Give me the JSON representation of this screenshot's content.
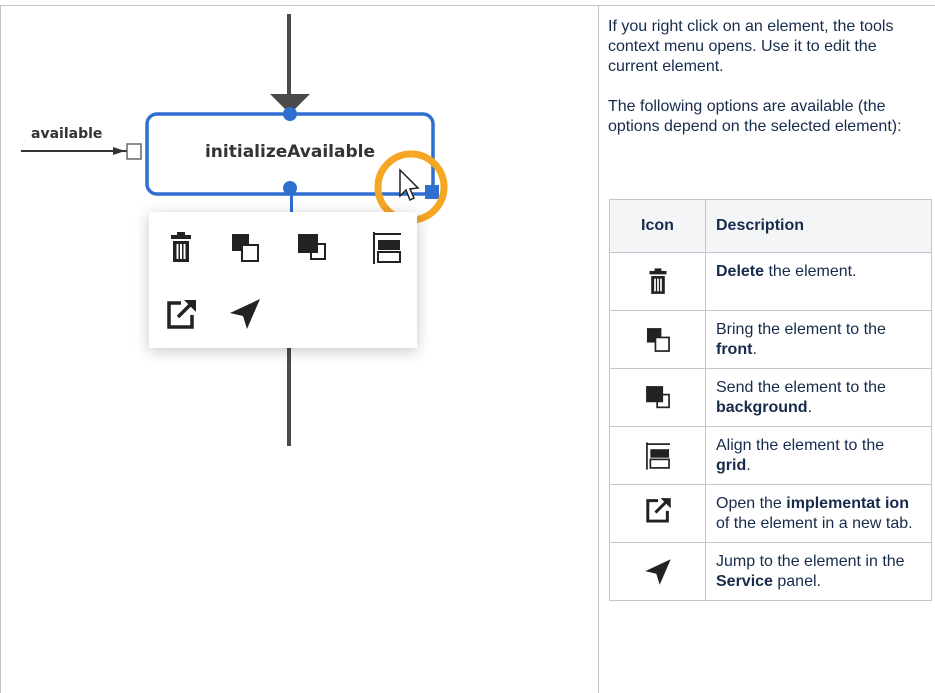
{
  "diagram": {
    "node_label": "initializeAvailable",
    "port_label": "available",
    "accent_color": "#2f6fd0",
    "highlight_color": "#f5a623",
    "context_menu_icons": [
      "trash-icon",
      "bring-to-front-icon",
      "send-to-back-icon",
      "align-to-grid-icon",
      "open-external-icon",
      "navigate-arrow-icon"
    ]
  },
  "intro": {
    "paragraph1": "If you right click on an element, the tools context menu opens. Use it to edit the current element.",
    "paragraph2": "The following options are available (the options depend on the selected element):"
  },
  "table": {
    "header_icon": "Icon",
    "header_description": "Description",
    "rows": [
      {
        "icon": "trash-icon",
        "before": "",
        "bold": "Delete",
        "after": " the element."
      },
      {
        "icon": "bring-to-front-icon",
        "before": "Bring the element to the ",
        "bold": "front",
        "after": "."
      },
      {
        "icon": "send-to-back-icon",
        "before": "Send the element to the ",
        "bold": "background",
        "after": "."
      },
      {
        "icon": "align-to-grid-icon",
        "before": "Align the element to the ",
        "bold": "grid",
        "after": "."
      },
      {
        "icon": "open-external-icon",
        "before": "Open the ",
        "bold": "implementat ion",
        "after": " of the element in a new tab."
      },
      {
        "icon": "navigate-arrow-icon",
        "before": "Jump to the element in the ",
        "bold": "Service",
        "after": " panel."
      }
    ]
  }
}
